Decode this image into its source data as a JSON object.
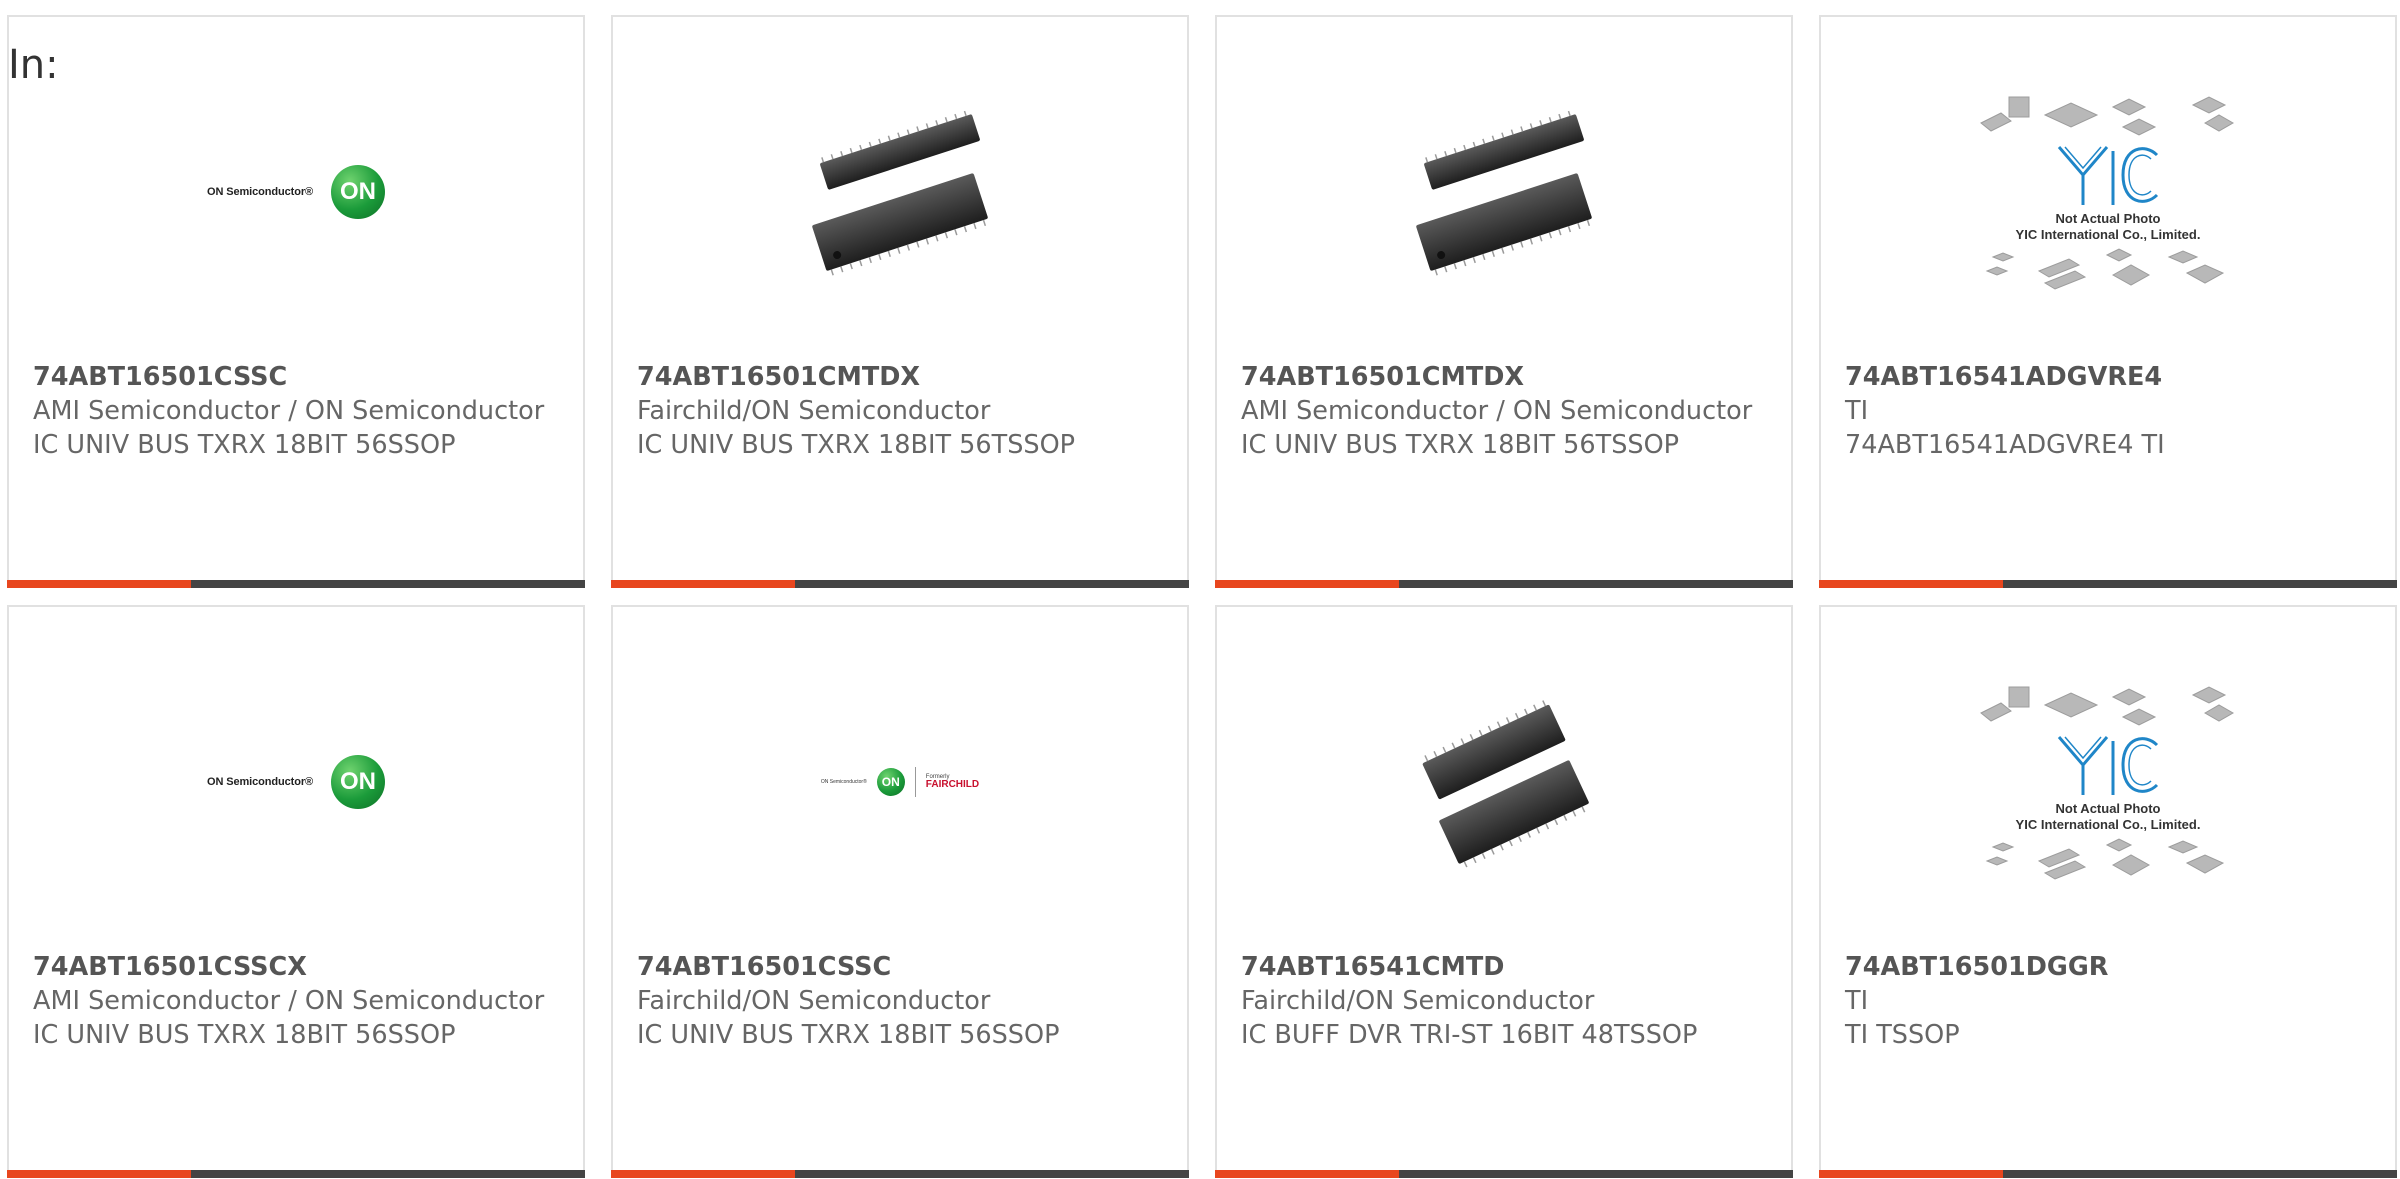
{
  "filter_label": "In:",
  "logo_text": {
    "on_semiconductor": "ON Semiconductor®",
    "on_badge": "ON",
    "formerly": "Formerly",
    "fairchild": "FAIRCHILD",
    "yic_not_actual": "Not Actual Photo",
    "yic_company": "YIC International Co., Limited."
  },
  "colors": {
    "accent": "#e8461e",
    "bar_dark": "#444444",
    "card_border": "#e1e1e1",
    "on_green": "#1b9b3a"
  },
  "products": [
    {
      "part_number": "74ABT16501CSSC",
      "manufacturer": "AMI Semiconductor / ON Semiconductor",
      "description": "IC UNIV BUS TXRX 18BIT 56SSOP",
      "image": "on-semiconductor-logo"
    },
    {
      "part_number": "74ABT16501CMTDX",
      "manufacturer": "Fairchild/ON Semiconductor",
      "description": "IC UNIV BUS TXRX 18BIT 56TSSOP",
      "image": "chip-package-photo"
    },
    {
      "part_number": "74ABT16501CMTDX",
      "manufacturer": "AMI Semiconductor / ON Semiconductor",
      "description": "IC UNIV BUS TXRX 18BIT 56TSSOP",
      "image": "chip-package-photo"
    },
    {
      "part_number": "74ABT16541ADGVRE4",
      "manufacturer": "TI",
      "description": "74ABT16541ADGVRE4 TI",
      "image": "yic-placeholder"
    },
    {
      "part_number": "74ABT16501CSSCX",
      "manufacturer": "AMI Semiconductor / ON Semiconductor",
      "description": "IC UNIV BUS TXRX 18BIT 56SSOP",
      "image": "on-semiconductor-logo"
    },
    {
      "part_number": "74ABT16501CSSC",
      "manufacturer": "Fairchild/ON Semiconductor",
      "description": "IC UNIV BUS TXRX 18BIT 56SSOP",
      "image": "on-fairchild-logo"
    },
    {
      "part_number": "74ABT16541CMTD",
      "manufacturer": "Fairchild/ON Semiconductor",
      "description": "IC BUFF DVR TRI-ST 16BIT 48TSSOP",
      "image": "chip-package-photo"
    },
    {
      "part_number": "74ABT16501DGGR",
      "manufacturer": "TI",
      "description": "TI TSSOP",
      "image": "yic-placeholder"
    }
  ]
}
